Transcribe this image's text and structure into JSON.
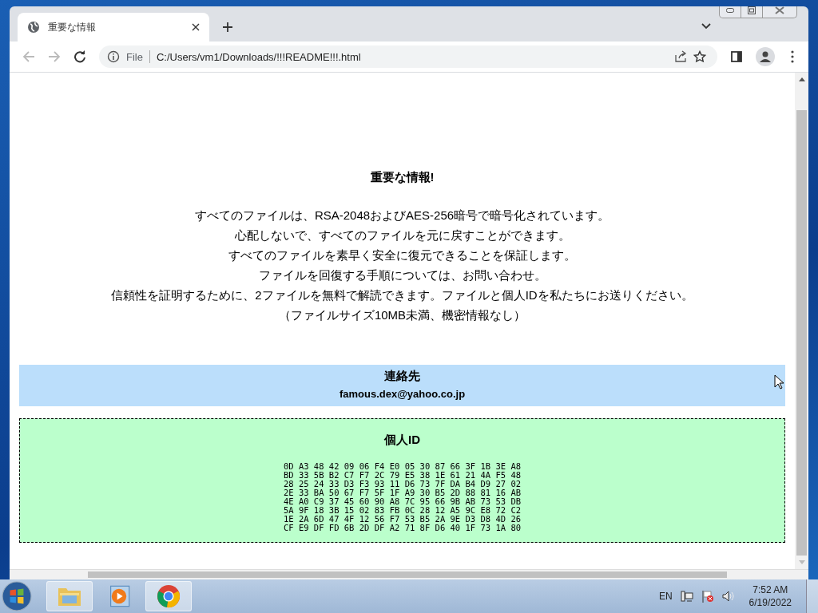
{
  "tabs": [
    {
      "title": "重要な情報",
      "selected": true
    }
  ],
  "address_bar": {
    "scheme": "File",
    "url": "C:/Users/vm1/Downloads/!!!README!!!.html"
  },
  "page": {
    "heading": "重要な情報!",
    "lines": [
      "すべてのファイルは、RSA-2048およびAES-256暗号で暗号化されています。",
      "心配しないで、すべてのファイルを元に戻すことができます。",
      "すべてのファイルを素早く安全に復元できることを保証します。",
      "ファイルを回復する手順については、お問い合わせ。",
      "信頼性を証明するために、2ファイルを無料で解読できます。ファイルと個人IDを私たちにお送りください。",
      "（ファイルサイズ10MB未満、機密情報なし）"
    ],
    "contact": {
      "title": "連絡先",
      "email": "famous.dex@yahoo.co.jp"
    },
    "personal_id": {
      "title": "個人ID",
      "rows": [
        "0D A3 48 42 09 06 F4 E0 05 30 87 66 3F 1B 3E A8",
        "BD 33 5B B2 C7 F7 2C 79 E5 38 1E 61 21 4A F5 48",
        "28 25 24 33 D3 F3 93 11 D6 73 7F DA B4 D9 27 02",
        "2E 33 BA 50 67 F7 5F 1F A9 30 B5 2D 88 81 16 AB",
        "4E A0 C9 37 45 60 90 A8 7C 95 66 9B AB 73 53 DB",
        "5A 9F 18 3B 15 02 83 FB 0C 28 12 A5 9C E8 72 C2",
        "1E 2A 6D 47 4F 12 56 F7 53 B5 2A 9E D3 D8 4D 26",
        "CF E9 DF FD 6B 2D DF A2 71 8F D6 40 1F 73 1A 80"
      ]
    }
  },
  "taskbar": {
    "apps": [
      {
        "kind": "folder",
        "running": true
      },
      {
        "kind": "media",
        "running": false
      },
      {
        "kind": "browser",
        "running": true
      }
    ],
    "language": "EN",
    "time": "7:52 AM",
    "date": "6/19/2022"
  }
}
